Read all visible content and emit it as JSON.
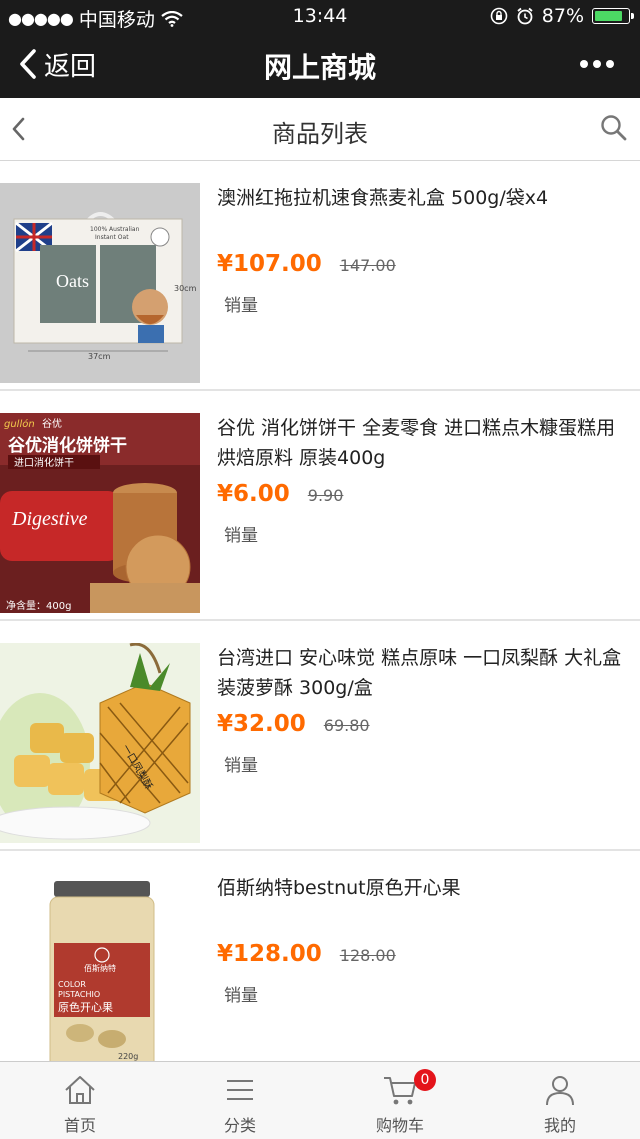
{
  "status": {
    "carrier": "中国移动",
    "time": "13:44",
    "battery": "87%",
    "battery_level": 0.87
  },
  "nav": {
    "back_label": "返回",
    "title": "网上商城"
  },
  "subheader": {
    "title": "商品列表"
  },
  "products": [
    {
      "name": "澳洲红拖拉机速食燕麦礼盒 500g/袋x4",
      "price": "¥107.00",
      "old_price": "147.00",
      "sales_label": "销量"
    },
    {
      "name": "谷优 消化饼饼干 全麦零食 进口糕点木糠蛋糕用烘焙原料 原装400g",
      "price": "¥6.00",
      "old_price": "9.90",
      "sales_label": "销量"
    },
    {
      "name": "台湾进口 安心味觉 糕点原味 一口凤梨酥 大礼盒装菠萝酥 300g/盒",
      "price": "¥32.00",
      "old_price": "69.80",
      "sales_label": "销量"
    },
    {
      "name": "佰斯纳特bestnut原色开心果",
      "price": "¥128.00",
      "old_price": "128.00",
      "sales_label": "销量"
    }
  ],
  "product_images": {
    "p1": {
      "w1": "100% Australian",
      "w2": "Instant Oat",
      "w3": "Oats",
      "w4": "30cm",
      "w5": "37cm"
    },
    "p2": {
      "w1": "gullón",
      "w2": "谷优",
      "w3": "谷优消化饼饼干",
      "w4": "进口消化饼干",
      "w5": "Digestive",
      "w6": "净含量：400g"
    },
    "p3": {
      "w1": "一口凤梨酥"
    },
    "p4": {
      "w1": "佰斯纳特",
      "w2": "COLOR",
      "w3": "PISTACHIO",
      "w4": "原色开心果",
      "w5": "220g"
    }
  },
  "tabs": [
    {
      "label": "首页",
      "icon": "home-icon"
    },
    {
      "label": "分类",
      "icon": "list-icon"
    },
    {
      "label": "购物车",
      "icon": "cart-icon",
      "badge": "0"
    },
    {
      "label": "我的",
      "icon": "user-icon"
    }
  ],
  "colors": {
    "bar_bg": "#1b1b1b",
    "price": "#ff6a00",
    "badge": "#e4141b"
  }
}
